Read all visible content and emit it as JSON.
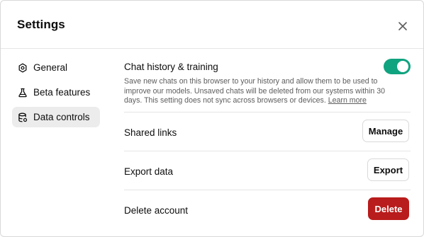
{
  "dialog": {
    "title": "Settings",
    "close_icon": "close-icon"
  },
  "sidebar": {
    "items": [
      {
        "label": "General",
        "icon": "gear-icon",
        "active": false
      },
      {
        "label": "Beta features",
        "icon": "flask-icon",
        "active": false
      },
      {
        "label": "Data controls",
        "icon": "database-icon",
        "active": true
      }
    ]
  },
  "chat_history": {
    "title": "Chat history & training",
    "description": "Save new chats on this browser to your history and allow them to be used to improve our models. Unsaved chats will be deleted from our systems within 30 days. This setting does not sync across browsers or devices.",
    "link_label": "Learn more",
    "toggle_on": true,
    "toggle_color": "#10a37f"
  },
  "rows": {
    "shared_links": {
      "label": "Shared links",
      "button": "Manage"
    },
    "export_data": {
      "label": "Export data",
      "button": "Export"
    },
    "delete_account": {
      "label": "Delete account",
      "button": "Delete",
      "button_color": "#b91c1c"
    }
  }
}
